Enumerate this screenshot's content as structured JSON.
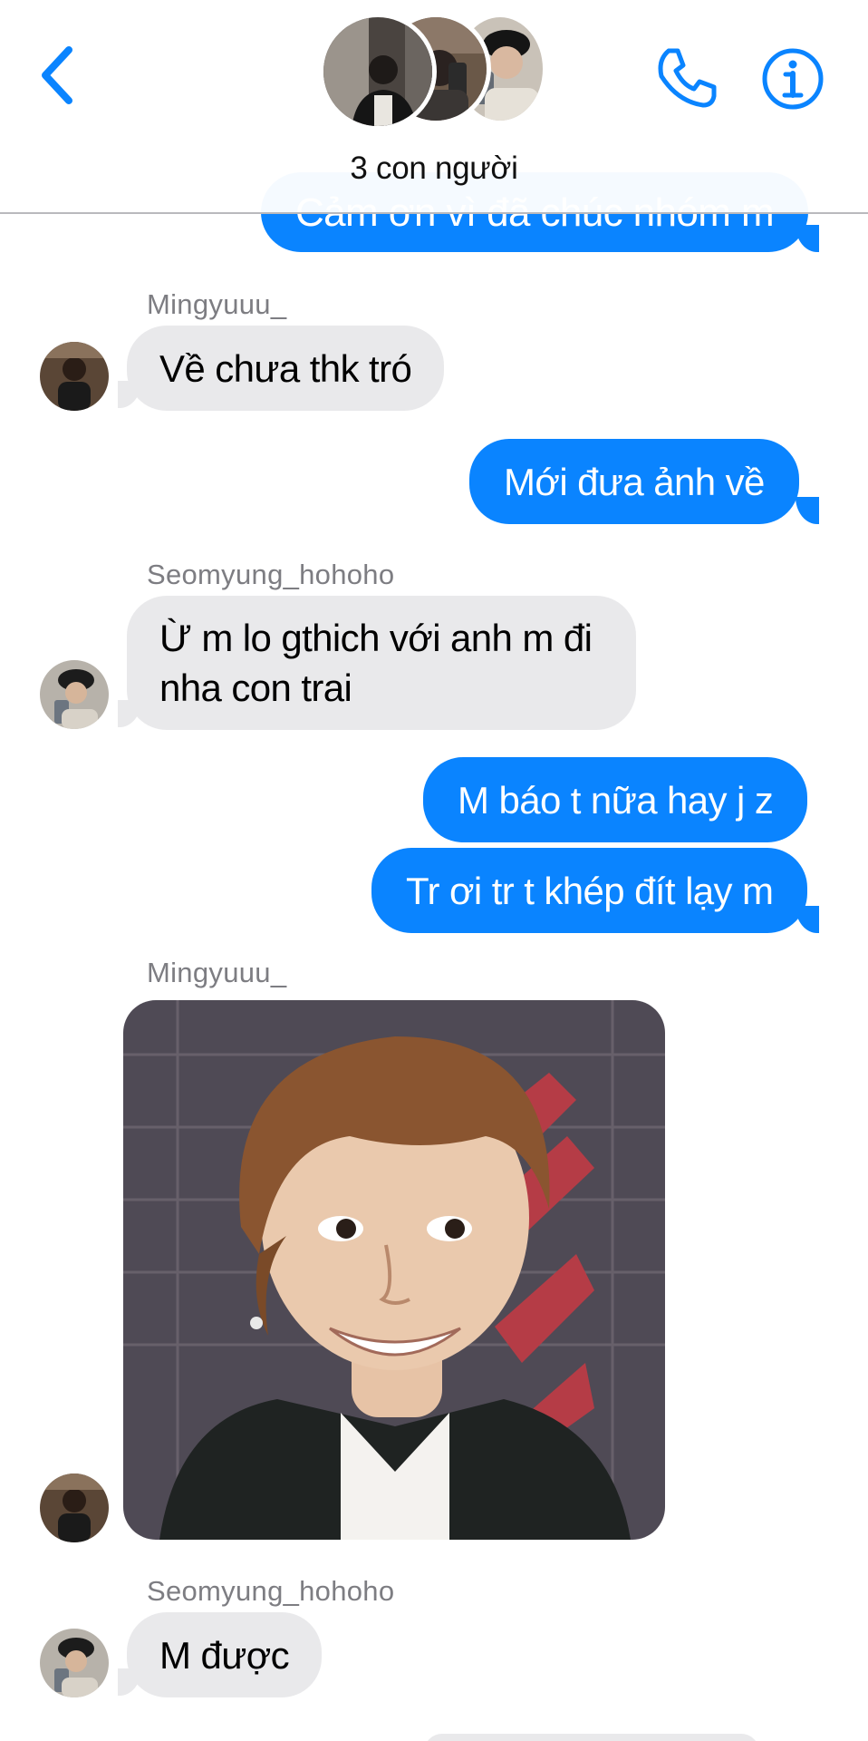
{
  "header": {
    "title": "3 con người",
    "accent_color": "#0a84ff",
    "back_icon": "chevron-left-icon",
    "call_icon": "phone-icon",
    "info_icon": "info-circle-icon"
  },
  "messages": {
    "top_partial": {
      "text": "Cảm ơn vì đã chúc nhóm m"
    },
    "m1": {
      "sender": "Mingyuuu_",
      "text": "Về chưa thk tró"
    },
    "m2": {
      "text": "Mới đưa ảnh về"
    },
    "m3": {
      "sender": "Seomyung_hohoho",
      "line1": "Ừ m lo gthich với anh m đi",
      "line2": "nha con trai"
    },
    "m4": {
      "text": "M báo t nữa hay j z"
    },
    "m5": {
      "text": "Tr ơi tr t khép đít lạy m"
    },
    "m6": {
      "sender": "Mingyuuu_",
      "image": "sticker-photo"
    },
    "m7": {
      "sender": "Seomyung_hohoho",
      "text": "M được"
    }
  },
  "colors": {
    "outgoing_bubble": "#0a84ff",
    "incoming_bubble": "#e9e9eb",
    "sender_name": "#7d7d82"
  }
}
